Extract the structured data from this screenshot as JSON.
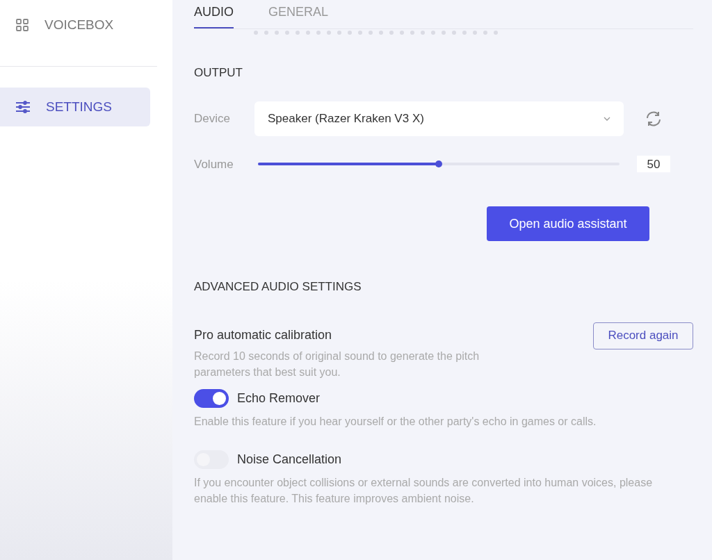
{
  "sidebar": {
    "items": [
      {
        "kind": "grid",
        "label": "VOICEBOX",
        "selected": false
      },
      {
        "kind": "sliders",
        "label": "SETTINGS",
        "selected": true
      }
    ]
  },
  "tabs": [
    {
      "label": "AUDIO",
      "selected": true
    },
    {
      "label": "GENERAL",
      "selected": false
    }
  ],
  "output": {
    "heading": "OUTPUT",
    "device_label": "Device",
    "device_value": "Speaker (Razer Kraken V3 X)",
    "volume_label": "Volume",
    "volume": {
      "level": 0.5
    },
    "volume_reading": "50",
    "assistant_button": "Open audio assistant"
  },
  "advanced": {
    "heading": "ADVANCED AUDIO SETTINGS",
    "calibration": {
      "title": "Pro automatic calibration",
      "description": "Record 10 seconds of original sound to generate the pitch parameters that best suit you.",
      "button": "Record again"
    },
    "toggles": [
      {
        "label": "Echo Remover",
        "on": true,
        "description": "Enable this feature if you hear yourself or the other party's echo in games or calls."
      },
      {
        "label": "Noise Cancellation",
        "on": false,
        "description": "If you encounter object collisions or external sounds are converted into human voices, please enable this feature. This feature improves ambient noise."
      }
    ]
  }
}
